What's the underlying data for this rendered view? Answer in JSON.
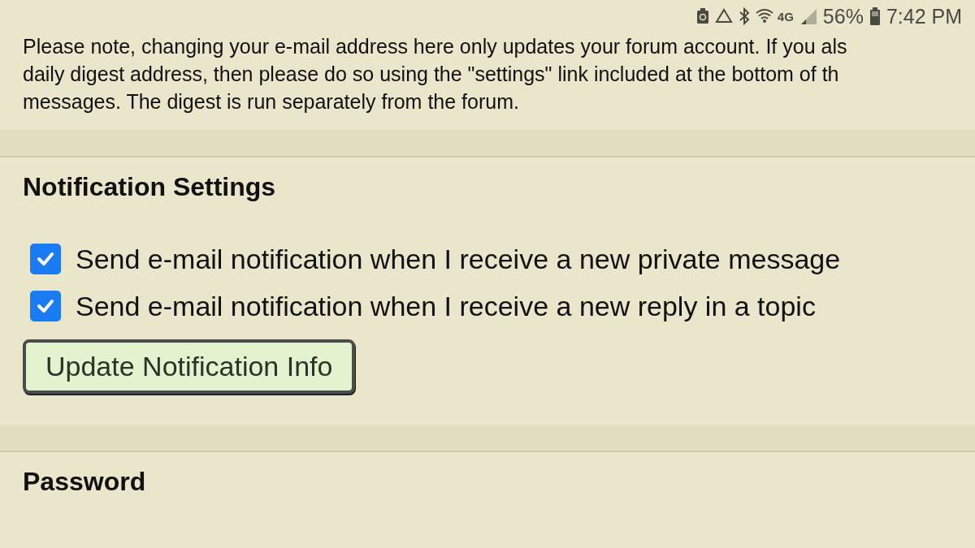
{
  "status_bar": {
    "network": "4G",
    "battery": "56%",
    "time": "7:42 PM"
  },
  "notice_lines": [
    "Please note, changing your e-mail address here only updates your forum account. If you als",
    "daily digest address, then please do so using the \"settings\" link included at the bottom of th",
    "messages. The digest is run separately from the forum."
  ],
  "notification_settings": {
    "title": "Notification Settings",
    "options": [
      {
        "label": "Send e-mail notification when I receive a new private message",
        "checked": true
      },
      {
        "label": "Send e-mail notification when I receive a new reply in a topic",
        "checked": true
      }
    ],
    "button": "Update Notification Info"
  },
  "password": {
    "title": "Password"
  }
}
